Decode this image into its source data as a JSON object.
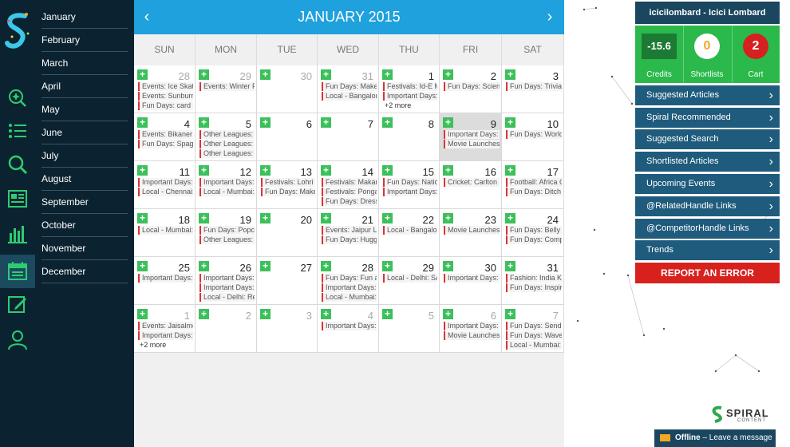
{
  "rail": {
    "icons": [
      "spiral-logo-icon",
      "discover-icon",
      "list-icon",
      "search-icon",
      "news-icon",
      "analytics-icon",
      "calendar-icon",
      "edit-icon",
      "user-icon"
    ]
  },
  "months": [
    "January",
    "February",
    "March",
    "April",
    "May",
    "June",
    "July",
    "August",
    "September",
    "October",
    "November",
    "December"
  ],
  "calendar": {
    "title": "JANUARY 2015",
    "prev": "‹",
    "next": "›",
    "weekdays": [
      "SUN",
      "MON",
      "TUE",
      "WED",
      "THU",
      "FRI",
      "SAT"
    ],
    "add_label": "+",
    "weeks": [
      [
        {
          "day": "28",
          "other": true,
          "events": [
            "Events: Ice Skatin",
            "Events: Sunburn",
            "Fun Days: card p"
          ]
        },
        {
          "day": "29",
          "other": true,
          "events": [
            "Events: Winter F"
          ]
        },
        {
          "day": "30",
          "other": true,
          "events": []
        },
        {
          "day": "31",
          "other": true,
          "events": [
            "Fun Days: Make",
            "Local - Bangalore"
          ]
        },
        {
          "day": "1",
          "events": [
            "Festivals: Id-E Mi",
            "Important Days:"
          ],
          "more": "+2 more"
        },
        {
          "day": "2",
          "events": [
            "Fun Days: Scienc"
          ]
        },
        {
          "day": "3",
          "events": [
            "Fun Days: Trivia"
          ]
        }
      ],
      [
        {
          "day": "4",
          "events": [
            "Events: Bikaner C",
            "Fun Days: Spagh"
          ]
        },
        {
          "day": "5",
          "events": [
            "Other Leagues: A",
            "Other Leagues: E",
            "Other Leagues: C"
          ]
        },
        {
          "day": "6",
          "events": []
        },
        {
          "day": "7",
          "events": []
        },
        {
          "day": "8",
          "events": []
        },
        {
          "day": "9",
          "today": true,
          "events": [
            "Important Days:",
            "Movie Launches:"
          ]
        },
        {
          "day": "10",
          "events": [
            "Fun Days: World"
          ]
        }
      ],
      [
        {
          "day": "11",
          "events": [
            "Important Days:",
            "Local - Chennai:"
          ]
        },
        {
          "day": "12",
          "events": [
            "Important Days:",
            "Local - Mumbai:"
          ]
        },
        {
          "day": "13",
          "events": [
            "Festivals: Lohri",
            "Fun Days: Make"
          ]
        },
        {
          "day": "14",
          "events": [
            "Festivals: Makar",
            "Festivals: Pongal",
            "Fun Days: Dress"
          ]
        },
        {
          "day": "15",
          "events": [
            "Fun Days: Nation",
            "Important Days:"
          ]
        },
        {
          "day": "16",
          "events": [
            "Cricket: Carlton M"
          ]
        },
        {
          "day": "17",
          "events": [
            "Football: Africa C",
            "Fun Days: Ditch N"
          ]
        }
      ],
      [
        {
          "day": "18",
          "events": [
            "Local - Mumbai:"
          ]
        },
        {
          "day": "19",
          "events": [
            "Fun Days: Popco",
            "Other Leagues: A"
          ]
        },
        {
          "day": "20",
          "events": []
        },
        {
          "day": "21",
          "events": [
            "Events: Jaipur Lit",
            "Fun Days: Huggi"
          ]
        },
        {
          "day": "22",
          "events": [
            "Local - Bangalore"
          ]
        },
        {
          "day": "23",
          "events": [
            "Movie Launches:"
          ]
        },
        {
          "day": "24",
          "events": [
            "Fun Days: Belly la",
            "Fun Days: Comp"
          ]
        }
      ],
      [
        {
          "day": "25",
          "events": [
            "Important Days:"
          ]
        },
        {
          "day": "26",
          "events": [
            "Important Days:",
            "Important Days:",
            "Local - Delhi: Rep"
          ]
        },
        {
          "day": "27",
          "events": []
        },
        {
          "day": "28",
          "events": [
            "Fun Days: Fun at",
            "Important Days:",
            "Local - Mumbai:"
          ]
        },
        {
          "day": "29",
          "events": [
            "Local - Delhi: SAT"
          ]
        },
        {
          "day": "30",
          "events": [
            "Important Days:"
          ]
        },
        {
          "day": "31",
          "events": [
            "Fashion: India Ki",
            "Fun Days: Inspire"
          ]
        }
      ],
      [
        {
          "day": "1",
          "other": true,
          "events": [
            "Events: Jaisalmer",
            "Important Days:"
          ],
          "more": "+2 more"
        },
        {
          "day": "2",
          "other": true,
          "events": []
        },
        {
          "day": "3",
          "other": true,
          "events": []
        },
        {
          "day": "4",
          "other": true,
          "events": [
            "Important Days:"
          ]
        },
        {
          "day": "5",
          "other": true,
          "events": []
        },
        {
          "day": "6",
          "other": true,
          "events": [
            "Important Days:",
            "Movie Launches:"
          ]
        },
        {
          "day": "7",
          "other": true,
          "events": [
            "Fun Days: Send a",
            "Fun Days: Wave",
            "Local - Mumbai:"
          ]
        }
      ]
    ]
  },
  "panel": {
    "account": "icicilombard - Icici Lombard",
    "credits_value": "-15.6",
    "credits_label": "Credits",
    "shortlists_value": "0",
    "shortlists_label": "Shortlists",
    "cart_value": "2",
    "cart_label": "Cart",
    "links": [
      "Suggested Articles",
      "Spiral Recommended",
      "Suggested Search",
      "Shortlisted Articles",
      "Upcoming Events",
      "@RelatedHandle Links",
      "@CompetitorHandle Links",
      "Trends"
    ],
    "report": "REPORT AN ERROR"
  },
  "brand": {
    "name": "SPIRAL",
    "sub": "CONTENT"
  },
  "chat": {
    "status": "Offline",
    "message": "Leave a message"
  },
  "colors": {
    "header": "#1ea1dc",
    "rail": "#0b2330",
    "accent_green": "#2ab94a",
    "report_red": "#d8201d",
    "link_bg": "#1f5b7c"
  }
}
